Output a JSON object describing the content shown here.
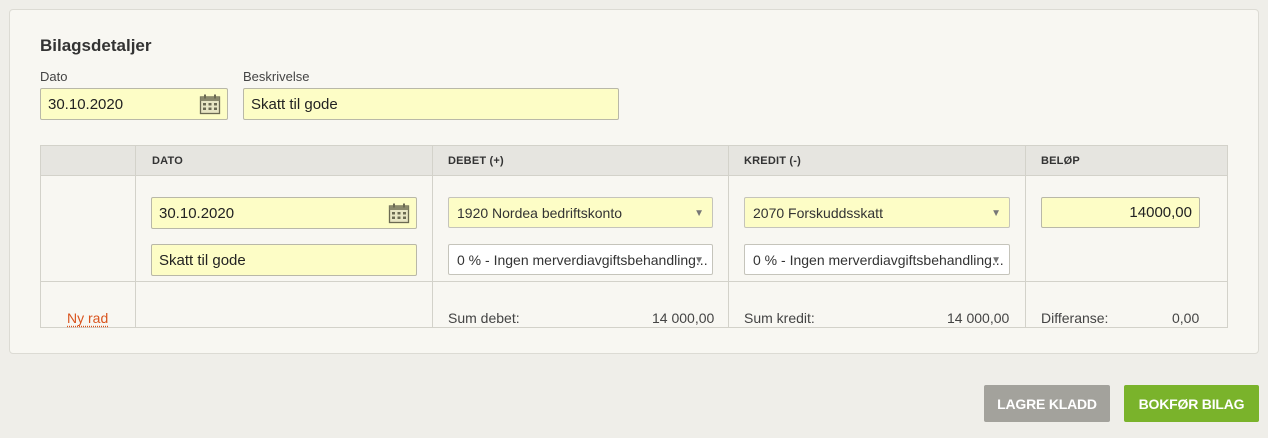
{
  "card": {
    "title": "Bilagsdetaljer"
  },
  "header": {
    "date_label": "Dato",
    "date_value": "30.10.2020",
    "desc_label": "Beskrivelse",
    "desc_value": "Skatt til gode"
  },
  "table": {
    "columns": [
      "",
      "DATO",
      "DEBET (+)",
      "KREDIT (-)",
      "BELØP"
    ],
    "row": {
      "date": "30.10.2020",
      "description": "Skatt til gode",
      "debit_account": "1920 Nordea bedriftskonto",
      "debit_vat": "0 % - Ingen merverdiavgiftsbehandling...",
      "credit_account": "2070 Forskuddsskatt",
      "credit_vat": "0 % - Ingen merverdiavgiftsbehandling...",
      "amount": "14000,00"
    },
    "footer": {
      "new_row": "Ny rad",
      "sum_debit_label": "Sum debet:",
      "sum_debit_value": "14 000,00",
      "sum_credit_label": "Sum kredit:",
      "sum_credit_value": "14 000,00",
      "difference_label": "Differanse:",
      "difference_value": "0,00"
    }
  },
  "actions": {
    "save_draft": "LAGRE KLADD",
    "post": "BOKFØR BILAG"
  },
  "colors": {
    "input_bg": "#fdfdc6",
    "link": "#d9541e",
    "save_button": "#a3a29c",
    "post_button": "#7ab32b"
  },
  "icons": [
    "calendar-icon",
    "chevron-down-icon"
  ]
}
